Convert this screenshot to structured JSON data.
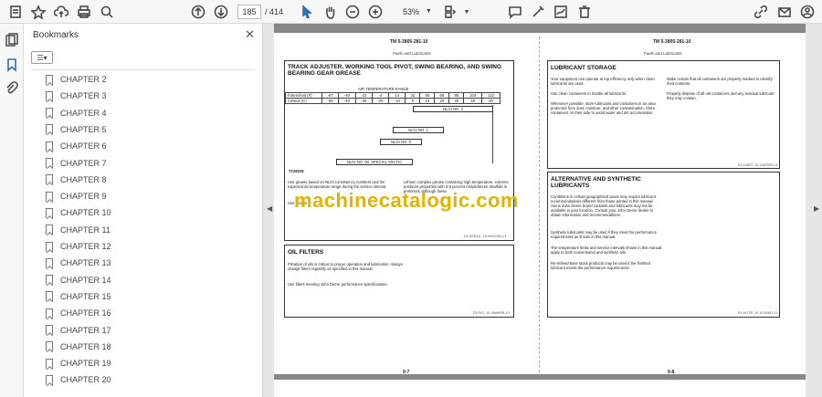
{
  "toolbar": {
    "page_current": "185",
    "page_total": "/ 414",
    "zoom": "53%"
  },
  "panel": {
    "title": "Bookmarks",
    "close": "✕",
    "options": "☰▾",
    "items": [
      {
        "label": "CHAPTER 2"
      },
      {
        "label": "CHAPTER 3"
      },
      {
        "label": "CHAPTER 4"
      },
      {
        "label": "CHAPTER 5"
      },
      {
        "label": "CHAPTER 6"
      },
      {
        "label": "CHAPTER 7"
      },
      {
        "label": "CHAPTER 8"
      },
      {
        "label": "CHAPTER 9"
      },
      {
        "label": "CHAPTER 10"
      },
      {
        "label": "CHAPTER 11"
      },
      {
        "label": "CHAPTER 12"
      },
      {
        "label": "CHAPTER 13"
      },
      {
        "label": "CHAPTER 14"
      },
      {
        "label": "CHAPTER 15"
      },
      {
        "label": "CHAPTER 16"
      },
      {
        "label": "CHAPTER 17"
      },
      {
        "label": "CHAPTER 18"
      },
      {
        "label": "CHAPTER 19"
      },
      {
        "label": "CHAPTER 20"
      }
    ]
  },
  "document": {
    "watermark": "machinecatalogic.com",
    "left_page": {
      "header": "TM 5-3805-281-10",
      "subheader": "Fuels and Lubricants",
      "section1": {
        "title": "TRACK ADJUSTER, WORKING TOOL PIVOT, SWING BEARING, AND SWING BEARING GEAR GREASE",
        "table_caption": "AIR TEMPERATURE RANGE",
        "row_f_label": "Fahrenheit (F)",
        "row_f": [
          "-67",
          "-40",
          "-22",
          "-4",
          "14",
          "32",
          "50",
          "68",
          "86",
          "104",
          "122"
        ],
        "row_c_label": "Celsius (C)",
        "row_c": [
          "-55",
          "-40",
          "-30",
          "-20",
          "-10",
          "0",
          "10",
          "20",
          "30",
          "40",
          "50"
        ],
        "bars": [
          "NLGI NO. 2",
          "NLGI NO. 1",
          "NLGI NO. 0",
          "NLGI NO. 00, SPECIAL ARCTIC"
        ],
        "fig_id": "T126028",
        "text_left": "Use grease based on NLGI consistency numbers and the expected air temperature range during the service interval.",
        "text_left2": "Use grease",
        "text_right": "Lithium complex grease containing high temperature, extreme pressure properties with 3-5 percent molybdenum disulfide is preferred, although these",
        "code": "DX,GREA11 -19-04NOV04-1/1"
      },
      "section2": {
        "title": "OIL FILTERS",
        "text1": "Filtration of oils is critical to proper operation and lubrication. Always change filters regularly as specified in this manual.",
        "text2": "Use filters meeting John Deere performance specifications.",
        "code": "DX,FILT -19-18MAR96-1/1"
      },
      "page_number": "9-7"
    },
    "right_page": {
      "header": "TM 5-3805-281-10",
      "subheader": "Fuels and Lubricants",
      "section1": {
        "title": "LUBRICANT STORAGE",
        "col1_p1": "Your equipment can operate at top efficiency only when clean lubricants are used.",
        "col1_p2": "Use clean containers to handle all lubricants.",
        "col1_p3": "Whenever possible, store lubricants and containers in an area protected from dust, moisture, and other contamination. Store containers on their side to avoid water and dirt accumulation.",
        "col2_p1": "Make certain that all containers are properly marked to identify their contents.",
        "col2_p2": "Properly dispose of all old containers and any residual lubricant they may contain.",
        "code": "DX,LUBST -19-11APR99-1/1"
      },
      "section2": {
        "title": "ALTERNATIVE AND SYNTHETIC LUBRICANTS",
        "p1": "Conditions in certain geographical areas may require lubricant recommendations different from those printed in this manual. Some John Deere brand coolants and lubricants may not be available in your location. Consult your John Deere dealer to obtain information and recommendations.",
        "p2": "Synthetic lubricants may be used if they meet the performance requirements as shown in this manual.",
        "p3": "The temperature limits and service intervals shown in this manual apply to both conventional and synthetic oils.",
        "p4": "Re-refined base stock products may be used if the finished lubricant meets the performance requirements.",
        "code": "DX,ALTER -19-15JUN00-1/1"
      },
      "page_number": "9-8"
    }
  }
}
